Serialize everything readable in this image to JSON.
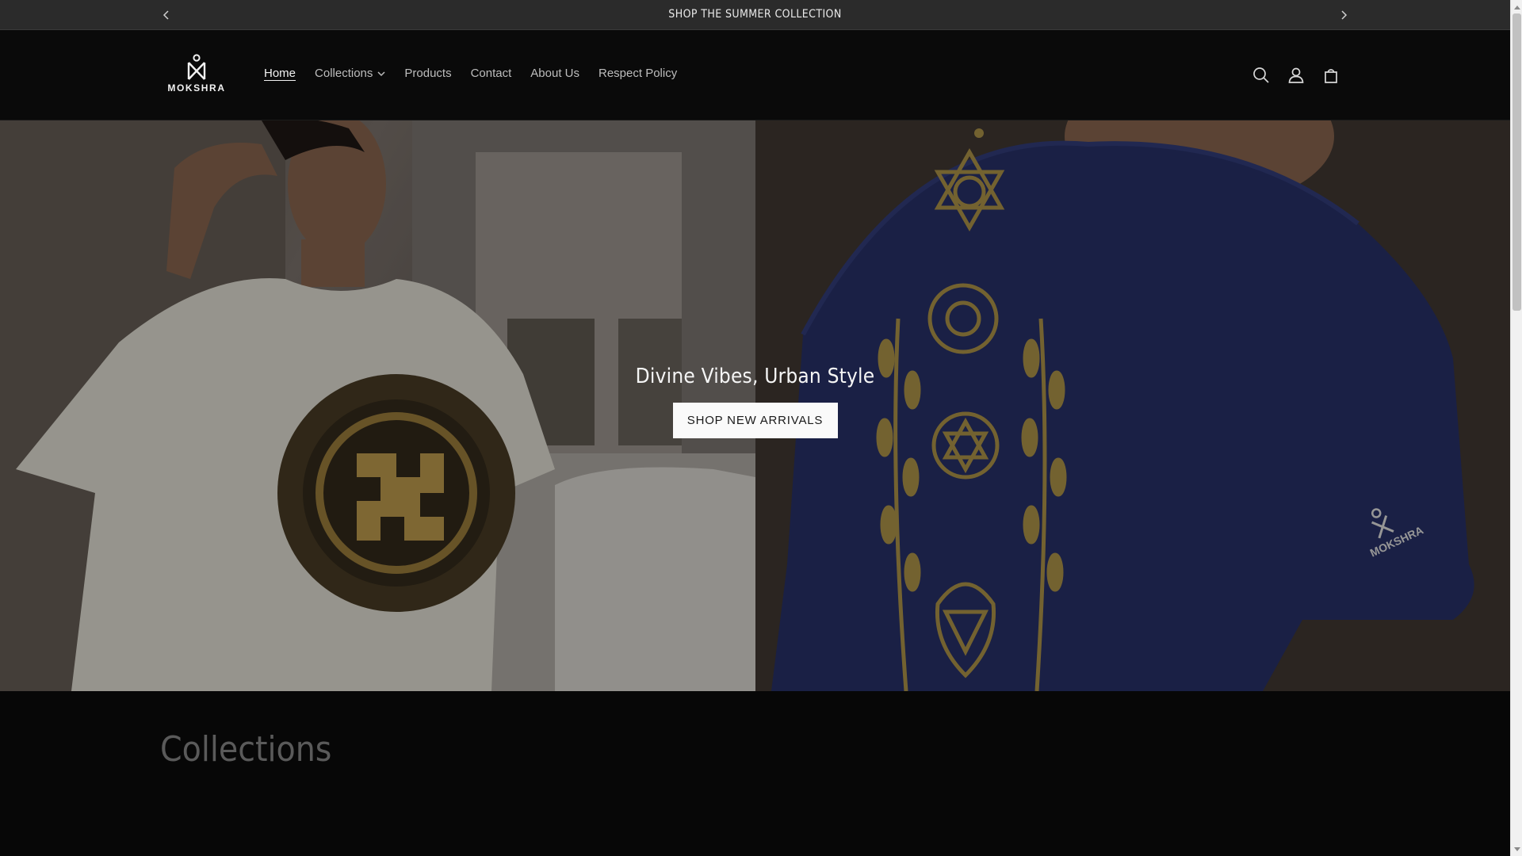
{
  "announcement": {
    "text": "SHOP THE SUMMER COLLECTION",
    "prev_icon": "chevron-left-icon",
    "next_icon": "chevron-right-icon"
  },
  "header": {
    "logo_text": "MOKSHRA",
    "nav": [
      {
        "label": "Home",
        "active": true
      },
      {
        "label": "Collections",
        "has_dropdown": true
      },
      {
        "label": "Products"
      },
      {
        "label": "Contact"
      },
      {
        "label": "About Us"
      },
      {
        "label": "Respect Policy"
      }
    ],
    "icons": [
      "search-icon",
      "account-icon",
      "cart-icon"
    ]
  },
  "hero": {
    "title": "Divine Vibes, Urban Style",
    "button_label": "SHOP NEW ARRIVALS",
    "sleeve_logo_text": "MOKSHRA"
  },
  "collections": {
    "title": "Collections"
  },
  "colors": {
    "background": "#070707",
    "announcement_bg": "#2b2b2b",
    "button_bg": "#fafafa",
    "shirt_blue": "#1f2a6b",
    "gold": "#b9993c"
  }
}
